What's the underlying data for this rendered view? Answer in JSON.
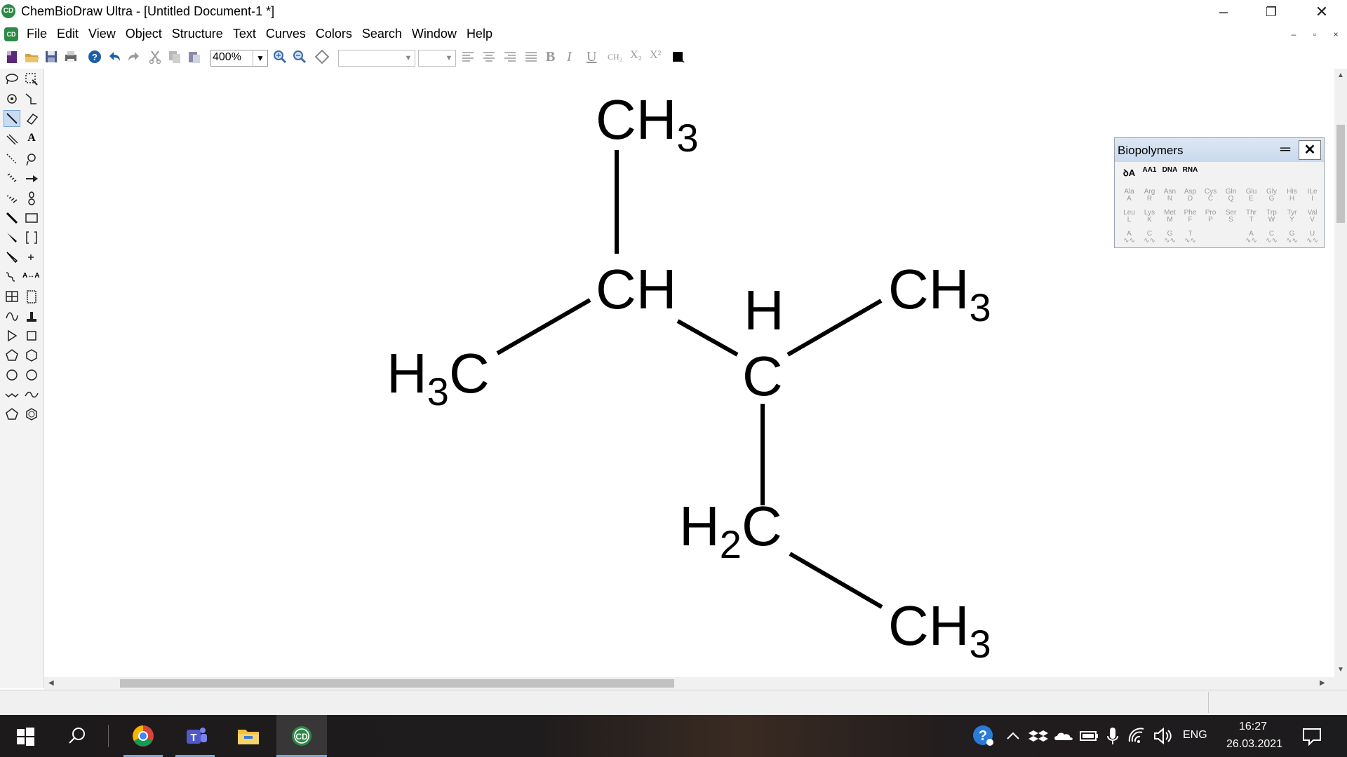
{
  "window": {
    "title": "ChemBioDraw Ultra - [Untitled Document-1 *]",
    "app_icon_text": "CD",
    "controls": [
      "–",
      "❐",
      "✕"
    ],
    "mdi_controls": [
      "–",
      "▫",
      "×"
    ]
  },
  "menu": {
    "items": [
      "File",
      "Edit",
      "View",
      "Object",
      "Structure",
      "Text",
      "Curves",
      "Colors",
      "Search",
      "Window",
      "Help"
    ]
  },
  "toolbar": {
    "zoom_value": "400%",
    "icons": [
      "new-document-icon",
      "open-icon",
      "save-icon",
      "print-icon",
      "help-icon",
      "undo-icon",
      "redo-icon",
      "cut-icon",
      "copy-icon",
      "paste-icon",
      "zoom-in-icon",
      "zoom-out-icon",
      "center-icon"
    ],
    "text_format": {
      "bold": "B",
      "italic": "I",
      "underline": "U",
      "formula": "CH₂",
      "subscript": "X₂",
      "superscript": "X²"
    }
  },
  "molecule": {
    "labels": {
      "top_ch3": {
        "main": "CH",
        "sub": "3"
      },
      "ch": {
        "main": "CH"
      },
      "left_ch3": {
        "h": "H",
        "sub": "3",
        "c": "C"
      },
      "center_h": "H",
      "center_c": "C",
      "right_ch3": {
        "main": "CH",
        "sub": "3"
      },
      "h2c": {
        "h": "H",
        "sub": "2",
        "c": "C"
      },
      "bottom_ch3": {
        "main": "CH",
        "sub": "3"
      }
    }
  },
  "biopolymers": {
    "title": "Biopolymers",
    "modes": [
      "AA1",
      "DNA",
      "RNA"
    ],
    "row1": [
      [
        "Ala",
        "A"
      ],
      [
        "Arg",
        "R"
      ],
      [
        "Asn",
        "N"
      ],
      [
        "Asp",
        "D"
      ],
      [
        "Cys",
        "C"
      ],
      [
        "Gln",
        "Q"
      ],
      [
        "Glu",
        "E"
      ],
      [
        "Gly",
        "G"
      ],
      [
        "His",
        "H"
      ],
      [
        "ILe",
        "I"
      ]
    ],
    "row2": [
      [
        "Leu",
        "L"
      ],
      [
        "Lys",
        "K"
      ],
      [
        "Met",
        "M"
      ],
      [
        "Phe",
        "F"
      ],
      [
        "Pro",
        "P"
      ],
      [
        "Ser",
        "S"
      ],
      [
        "Thr",
        "T"
      ],
      [
        "Trp",
        "W"
      ],
      [
        "Tyr",
        "Y"
      ],
      [
        "Val",
        "V"
      ]
    ],
    "row3": [
      "A",
      "C",
      "G",
      "T",
      "",
      "",
      "A",
      "C",
      "G",
      "U"
    ]
  },
  "taskbar": {
    "time": "16:27",
    "date": "26.03.2021",
    "language": "ENG"
  }
}
